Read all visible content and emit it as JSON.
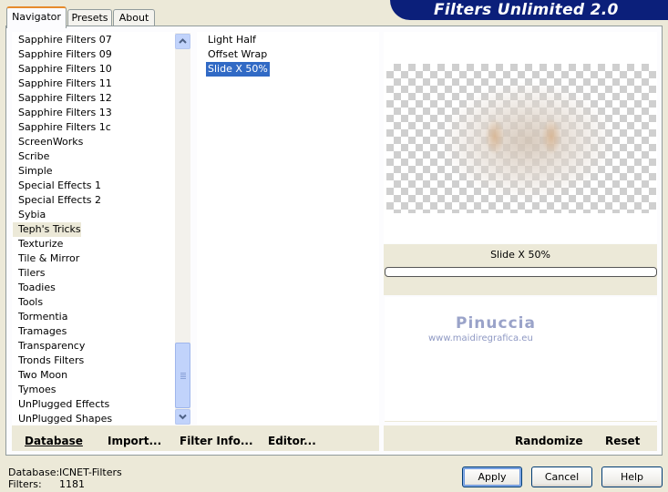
{
  "app": {
    "title": "Filters Unlimited 2.0"
  },
  "tabs": [
    {
      "label": "Navigator",
      "active": true
    },
    {
      "label": "Presets",
      "active": false
    },
    {
      "label": "About",
      "active": false
    }
  ],
  "categories": {
    "items": [
      "Sapphire Filters 07",
      "Sapphire Filters 09",
      "Sapphire Filters 10",
      "Sapphire Filters 11",
      "Sapphire Filters 12",
      "Sapphire Filters 13",
      "Sapphire Filters 1c",
      "ScreenWorks",
      "Scribe",
      "Simple",
      "Special Effects 1",
      "Special Effects 2",
      "Sybia",
      "Teph's Tricks",
      "Texturize",
      "Tile & Mirror",
      "Tilers",
      "Toadies",
      "Tools",
      "Tormentia",
      "Tramages",
      "Transparency",
      "Tronds Filters",
      "Two Moon",
      "Tymoes",
      "UnPlugged Effects",
      "UnPlugged Shapes"
    ],
    "selected": "Teph's Tricks"
  },
  "filters": {
    "items": [
      "Light Half",
      "Offset Wrap",
      "Slide X 50%"
    ],
    "selected": "Slide X 50%"
  },
  "preview": {
    "filter_name": "Slide X 50%"
  },
  "watermark": {
    "name": "Pinuccia",
    "url": "www.maidiregrafica.eu"
  },
  "actions": {
    "database": "Database",
    "import": "Import...",
    "filter_info": "Filter Info...",
    "editor": "Editor...",
    "randomize": "Randomize",
    "reset": "Reset"
  },
  "status": {
    "database_label": "Database:",
    "database_value": "ICNET-Filters",
    "filters_label": "Filters:",
    "filters_value": "1181"
  },
  "buttons": {
    "apply": "Apply",
    "cancel": "Cancel",
    "help": "Help"
  },
  "colors": {
    "banner": "#0b1f7a",
    "selection": "#316ac5",
    "tab_accent": "#e68b2c"
  }
}
